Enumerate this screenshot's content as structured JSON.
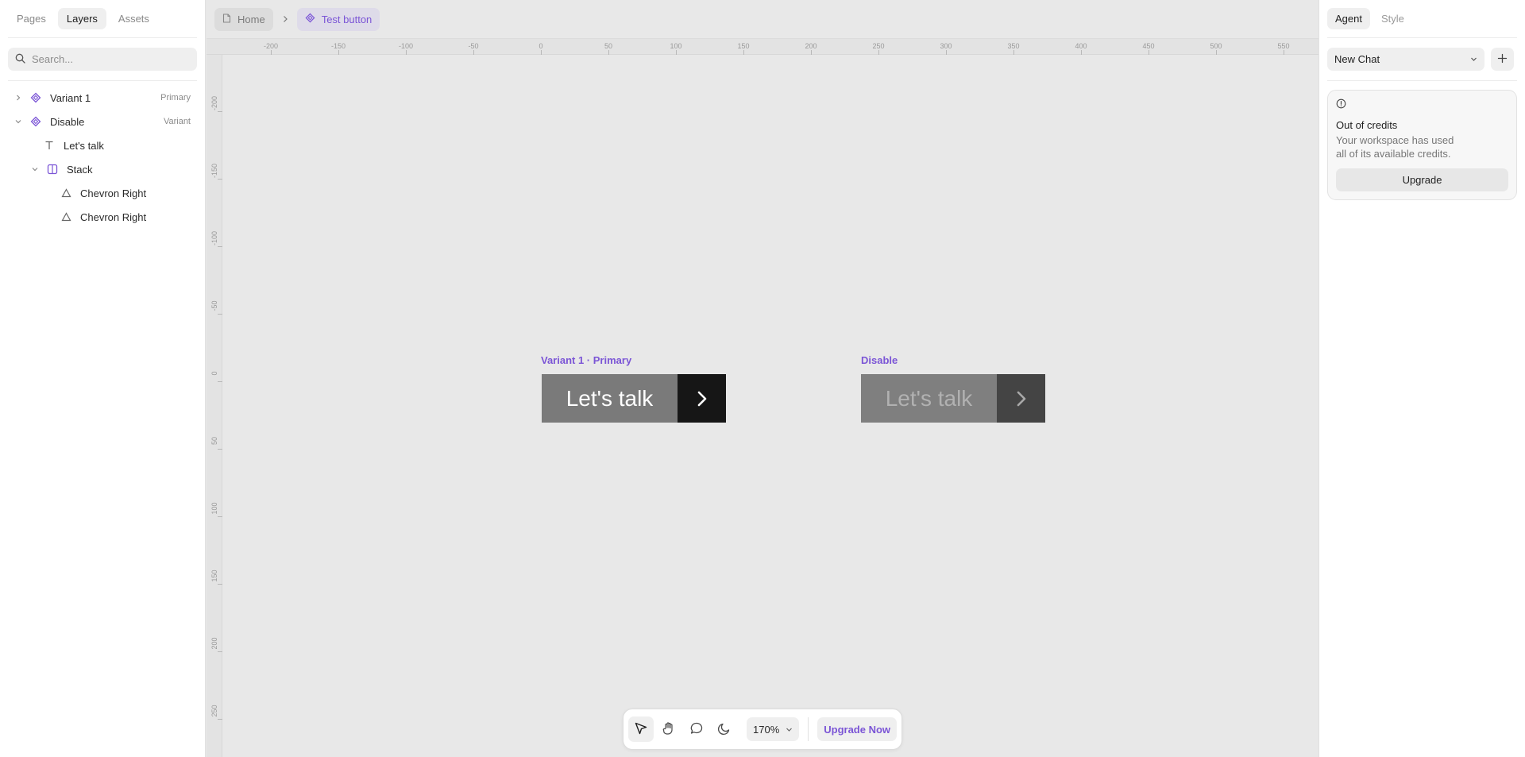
{
  "left_panel": {
    "tabs": [
      {
        "label": "Pages",
        "active": false
      },
      {
        "label": "Layers",
        "active": true
      },
      {
        "label": "Assets",
        "active": false
      }
    ],
    "search": {
      "placeholder": "Search..."
    },
    "layers": [
      {
        "name": "Variant 1",
        "tag": "Primary",
        "icon": "component-icon",
        "expanded": false
      },
      {
        "name": "Disable",
        "tag": "Variant",
        "icon": "component-icon",
        "expanded": true
      },
      {
        "name": "Let's talk",
        "tag": "",
        "icon": "text-icon"
      },
      {
        "name": "Stack",
        "tag": "",
        "icon": "stack-icon",
        "expanded": true
      },
      {
        "name": "Chevron Right",
        "tag": "",
        "icon": "vector-icon"
      },
      {
        "name": "Chevron Right",
        "tag": "",
        "icon": "vector-icon"
      }
    ]
  },
  "breadcrumb": {
    "home": "Home",
    "current": "Test button"
  },
  "rulers": {
    "x_labels": [
      "-200",
      "-150",
      "-100",
      "-50",
      "0",
      "50",
      "100",
      "150",
      "200",
      "250",
      "300",
      "350",
      "400",
      "450",
      "500",
      "550"
    ],
    "y_labels": [
      "-200",
      "-150",
      "-100",
      "-50",
      "0",
      "50",
      "100",
      "150",
      "200",
      "250"
    ]
  },
  "canvas": {
    "variant1": {
      "label": "Variant 1 · Primary",
      "button_text": "Let's talk"
    },
    "disable": {
      "label": "Disable",
      "button_text": "Let's talk"
    }
  },
  "toolbar": {
    "zoom": "170%",
    "upgrade_label": "Upgrade Now"
  },
  "right_panel": {
    "tabs": [
      {
        "label": "Agent",
        "active": true
      },
      {
        "label": "Style",
        "active": false
      }
    ],
    "chat_select": "New Chat",
    "credits": {
      "title": "Out of credits",
      "text": "Your workspace has used all of its available credits.",
      "button": "Upgrade"
    }
  },
  "colors": {
    "accent": "#7b55d6",
    "canvas_bg": "#e8e8e8",
    "primary_main": "#7a7a7a",
    "primary_arrow": "#161616",
    "disabled_main": "#7f7f7f",
    "disabled_arrow": "#444444"
  }
}
